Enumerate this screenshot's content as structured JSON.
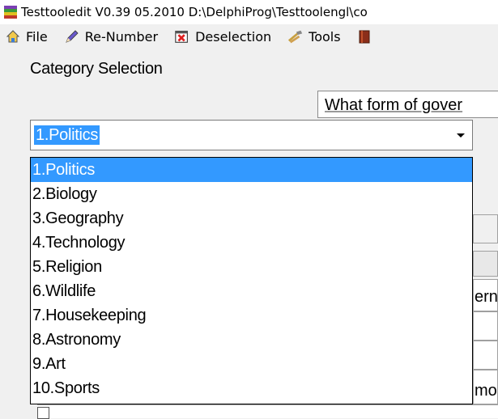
{
  "window": {
    "title": "Testtooledit V0.39 05.2010 D:\\DelphiProg\\Testtoolengl\\co"
  },
  "menu": {
    "items": [
      {
        "label": "File",
        "icon": "home-icon"
      },
      {
        "label": "Re-Number",
        "icon": "pencil-icon"
      },
      {
        "label": "Deselection",
        "icon": "deselect-icon"
      },
      {
        "label": "Tools",
        "icon": "tools-icon"
      }
    ]
  },
  "category": {
    "label": "Category Selection",
    "selected": "1.Politics",
    "options": [
      "1.Politics",
      "2.Biology",
      "3.Geography",
      "4.Technology",
      "5.Religion",
      "6.Wildlife",
      "7.Housekeeping",
      "8.Astronomy",
      "9.Art",
      "10.Sports"
    ]
  },
  "question": {
    "text": "What form of gover"
  },
  "right_fragments": {
    "row1": "ernı",
    "row2": "mo"
  },
  "colors": {
    "selection": "#3399ff",
    "background": "#f0f0f0"
  }
}
